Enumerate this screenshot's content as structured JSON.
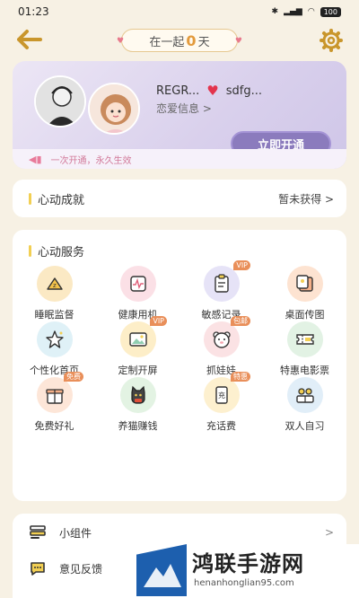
{
  "status_bar": {
    "time": "01:23",
    "battery": "100"
  },
  "header": {
    "days_prefix": "在一起",
    "days_count": "0",
    "days_suffix": "天"
  },
  "couple": {
    "name_left": "REGR...",
    "name_right": "sdfg...",
    "love_info": "恋爱信息 >",
    "open_button": "立即开通",
    "promo": "一次开通，永久生效"
  },
  "achievement": {
    "title": "心动成就",
    "value": "暂未获得 >"
  },
  "services": {
    "title": "心动服务",
    "items": [
      {
        "label": "睡眠监督",
        "icon": "sleep-icon",
        "bg": "#fbe9c4",
        "tag": ""
      },
      {
        "label": "健康用机",
        "icon": "health-monitor-icon",
        "bg": "#fbe0e6",
        "tag": ""
      },
      {
        "label": "敏感记录",
        "icon": "clipboard-icon",
        "bg": "#e6e3f7",
        "tag": "VIP"
      },
      {
        "label": "桌面传图",
        "icon": "photo-share-icon",
        "bg": "#fde3d1",
        "tag": ""
      },
      {
        "label": "个性化首页",
        "icon": "sparkle-star-icon",
        "bg": "#dff1f7",
        "tag": ""
      },
      {
        "label": "定制开屏",
        "icon": "image-frame-icon",
        "bg": "#fdeec8",
        "tag": "VIP"
      },
      {
        "label": "抓娃娃",
        "icon": "bear-icon",
        "bg": "#fbe2e4",
        "tag": "包邮"
      },
      {
        "label": "特惠电影票",
        "icon": "ticket-icon",
        "bg": "#e2f2e4",
        "tag": ""
      },
      {
        "label": "免费好礼",
        "icon": "gift-icon",
        "bg": "#fde6d8",
        "tag": "免费"
      },
      {
        "label": "养猫赚钱",
        "icon": "cat-icon",
        "bg": "#e3f3e3",
        "tag": ""
      },
      {
        "label": "充话费",
        "icon": "phone-charge-icon",
        "bg": "#fdf0cf",
        "tag": "特惠"
      },
      {
        "label": "双人自习",
        "icon": "study-couple-icon",
        "bg": "#e1eef8",
        "tag": ""
      }
    ]
  },
  "list": {
    "widget_label": "小组件",
    "feedback_label": "意见反馈",
    "chevron": ">"
  },
  "watermark": {
    "title": "鸿联手游网",
    "url": "henanhonglian95.com"
  },
  "colors": {
    "background": "#f7f1e4",
    "accent_purple": "#8b7bbd",
    "accent_gold": "#c9962c",
    "heart_red": "#e3344d"
  }
}
